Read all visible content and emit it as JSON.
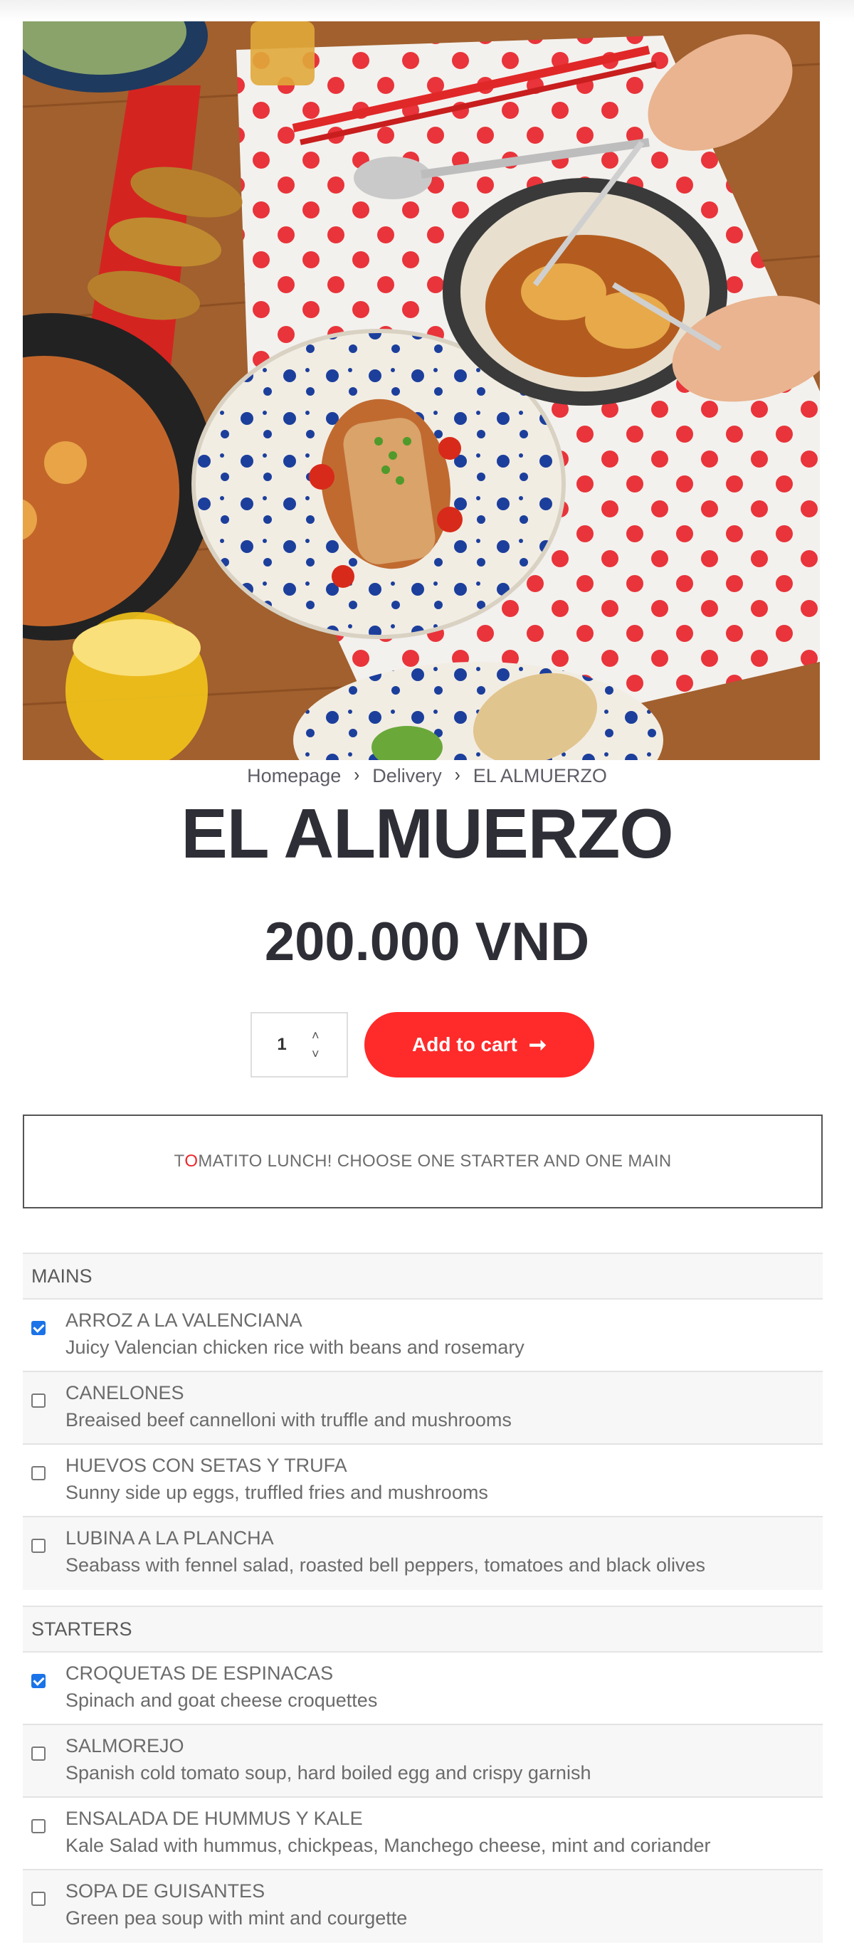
{
  "breadcrumb": {
    "home": "Homepage",
    "delivery": "Delivery",
    "current": "EL ALMUERZO"
  },
  "product": {
    "title": "EL ALMUERZO",
    "price": "200.000 VND"
  },
  "cart": {
    "quantity": "1",
    "add_label": "Add to cart",
    "add_arrow": "➞"
  },
  "notice": {
    "first": "T",
    "accent": "O",
    "rest": "MATITO LUNCH! CHOOSE ONE STARTER AND ONE MAIN"
  },
  "groups": {
    "mains": {
      "label": "MAINS",
      "items": [
        {
          "name": "ARROZ A LA VALENCIANA",
          "desc": "Juicy Valencian chicken rice with beans and rosemary",
          "checked": true
        },
        {
          "name": "CANELONES",
          "desc": "Breaised beef cannelloni with truffle and mushrooms",
          "checked": false
        },
        {
          "name": "HUEVOS CON SETAS Y TRUFA",
          "desc": "Sunny side up eggs, truffled fries and mushrooms",
          "checked": false
        },
        {
          "name": "LUBINA A LA PLANCHA",
          "desc": "Seabass with fennel salad, roasted bell peppers, tomatoes and black olives",
          "checked": false
        }
      ]
    },
    "starters": {
      "label": "STARTERS",
      "items": [
        {
          "name": "CROQUETAS DE ESPINACAS",
          "desc": "Spinach and goat cheese croquettes",
          "checked": true
        },
        {
          "name": "SALMOREJO",
          "desc": "Spanish cold tomato soup, hard boiled egg and crispy garnish",
          "checked": false
        },
        {
          "name": "ENSALADA DE HUMMUS Y KALE",
          "desc": "Kale Salad with hummus, chickpeas, Manchego cheese, mint and coriander",
          "checked": false
        },
        {
          "name": "SOPA DE GUISANTES",
          "desc": "Green pea soup with mint and courgette",
          "checked": false
        }
      ]
    }
  },
  "colors": {
    "accent": "#ff2a2a",
    "checkbox": "#1a73e8",
    "text": "#2e2e36"
  }
}
